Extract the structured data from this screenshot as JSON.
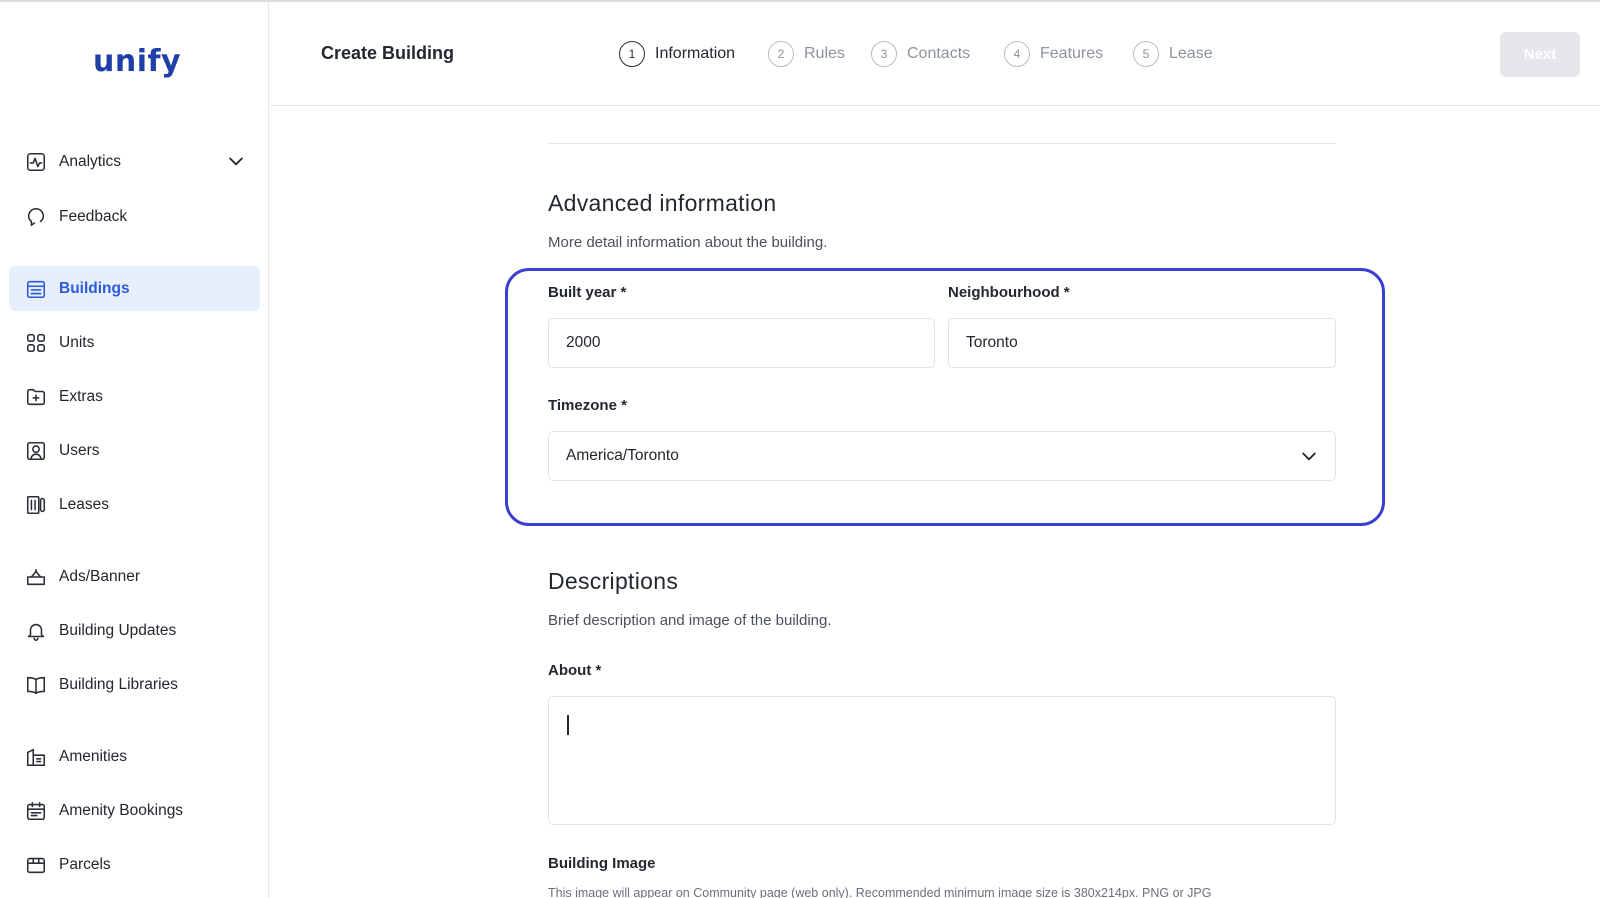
{
  "app": {
    "logo_text": "unify"
  },
  "sidebar": {
    "items": [
      {
        "label": "Analytics",
        "icon": "analytics-icon"
      },
      {
        "label": "Feedback",
        "icon": "feedback-icon"
      },
      {
        "label": "Buildings",
        "icon": "buildings-icon",
        "active": true
      },
      {
        "label": "Units",
        "icon": "units-grid-icon"
      },
      {
        "label": "Extras",
        "icon": "extras-folder-icon"
      },
      {
        "label": "Users",
        "icon": "users-icon"
      },
      {
        "label": "Leases",
        "icon": "leases-icon"
      },
      {
        "label": "Ads/Banner",
        "icon": "ads-banner-icon"
      },
      {
        "label": "Building Updates",
        "icon": "bell-icon"
      },
      {
        "label": "Building Libraries",
        "icon": "book-icon"
      },
      {
        "label": "Amenities",
        "icon": "amenities-icon"
      },
      {
        "label": "Amenity Bookings",
        "icon": "calendar-icon"
      },
      {
        "label": "Parcels",
        "icon": "parcel-icon"
      }
    ]
  },
  "header": {
    "title": "Create Building",
    "steps": [
      {
        "number": "1",
        "label": "Information",
        "active": true
      },
      {
        "number": "2",
        "label": "Rules"
      },
      {
        "number": "3",
        "label": "Contacts"
      },
      {
        "number": "4",
        "label": "Features"
      },
      {
        "number": "5",
        "label": "Lease"
      }
    ],
    "next_label": "Next"
  },
  "advanced": {
    "title": "Advanced information",
    "subtitle": "More detail information about the building.",
    "built_year": {
      "label": "Built year *",
      "value": "2000"
    },
    "neighbourhood": {
      "label": "Neighbourhood *",
      "value": "Toronto"
    },
    "timezone": {
      "label": "Timezone *",
      "value": "America/Toronto"
    }
  },
  "descriptions": {
    "title": "Descriptions",
    "subtitle": "Brief description and image of the building.",
    "about_label": "About *",
    "about_value": "",
    "image_label": "Building Image",
    "image_hint": "This image will appear on Community page (web only). Recommended minimum image size is 380x214px. PNG or JPG"
  },
  "colors": {
    "accent": "#2d5bd8",
    "highlight": "#3a3fd0",
    "active_bg": "#e7eefc"
  }
}
